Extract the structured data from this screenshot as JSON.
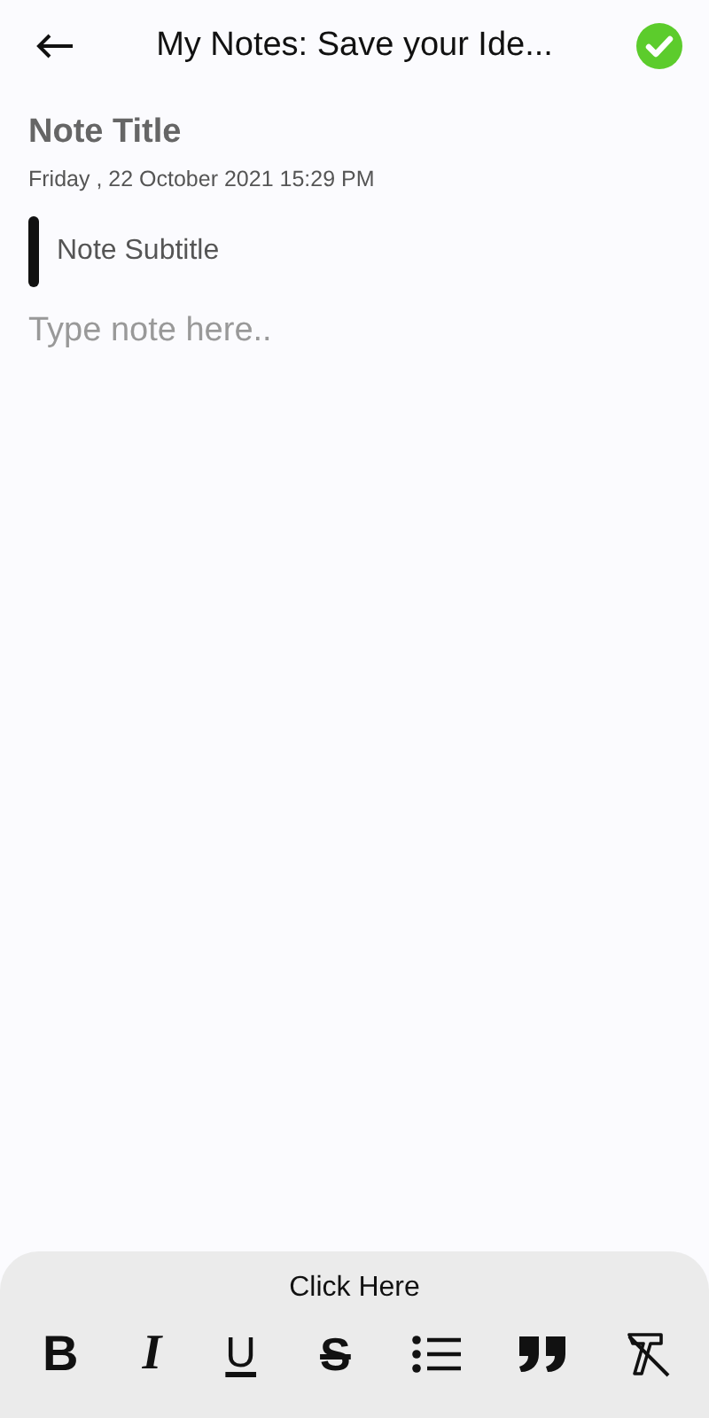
{
  "header": {
    "title": "My Notes: Save your Ide..."
  },
  "note": {
    "title_placeholder": "Note Title",
    "date": "Friday , 22 October 2021 15:29 PM",
    "subtitle_placeholder": "Note Subtitle",
    "body_placeholder": "Type note here.."
  },
  "toolbar": {
    "label": "Click Here",
    "tools": [
      {
        "kind": "bold",
        "glyph": "B"
      },
      {
        "kind": "italic",
        "glyph": "I"
      },
      {
        "kind": "underline",
        "glyph": "U"
      },
      {
        "kind": "strike",
        "glyph": "S"
      },
      {
        "kind": "list"
      },
      {
        "kind": "quote"
      },
      {
        "kind": "clear"
      }
    ]
  }
}
